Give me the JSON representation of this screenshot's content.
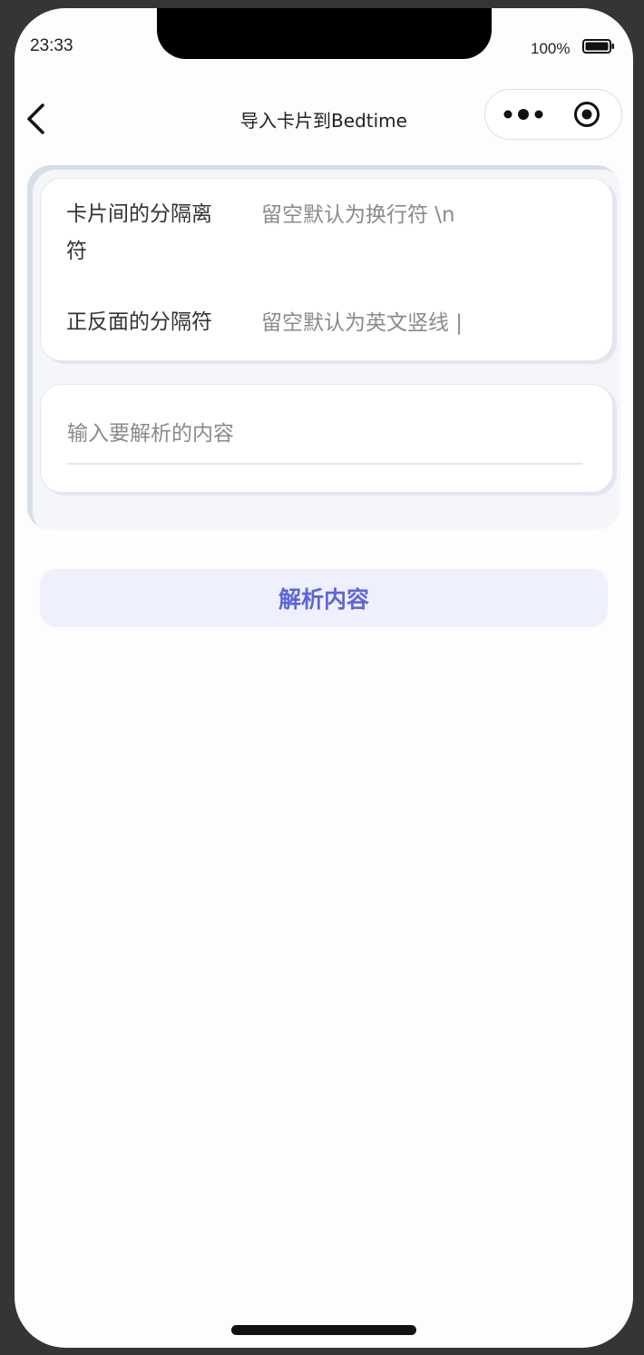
{
  "status_bar": {
    "time": "23:33",
    "battery_text": "100%",
    "battery_level": 1.0
  },
  "nav": {
    "title": "导入卡片到Bedtime",
    "back_icon": "chevron-left-icon",
    "more_icon": "more-dots-icon",
    "close_icon": "target-circle-icon"
  },
  "form": {
    "card_separator": {
      "label": "卡片间的分隔离符",
      "placeholder": "留空默认为换行符 \\n",
      "value": ""
    },
    "face_separator": {
      "label": "正反面的分隔符",
      "placeholder": "留空默认为英文竖线 |",
      "value": ""
    },
    "content": {
      "placeholder": "输入要解析的内容",
      "value": ""
    }
  },
  "actions": {
    "parse_label": "解析内容"
  },
  "colors": {
    "accent": "#5d66d8",
    "button_bg": "#eef1fd",
    "background": "#fdfdfd",
    "frame": "#353535"
  }
}
